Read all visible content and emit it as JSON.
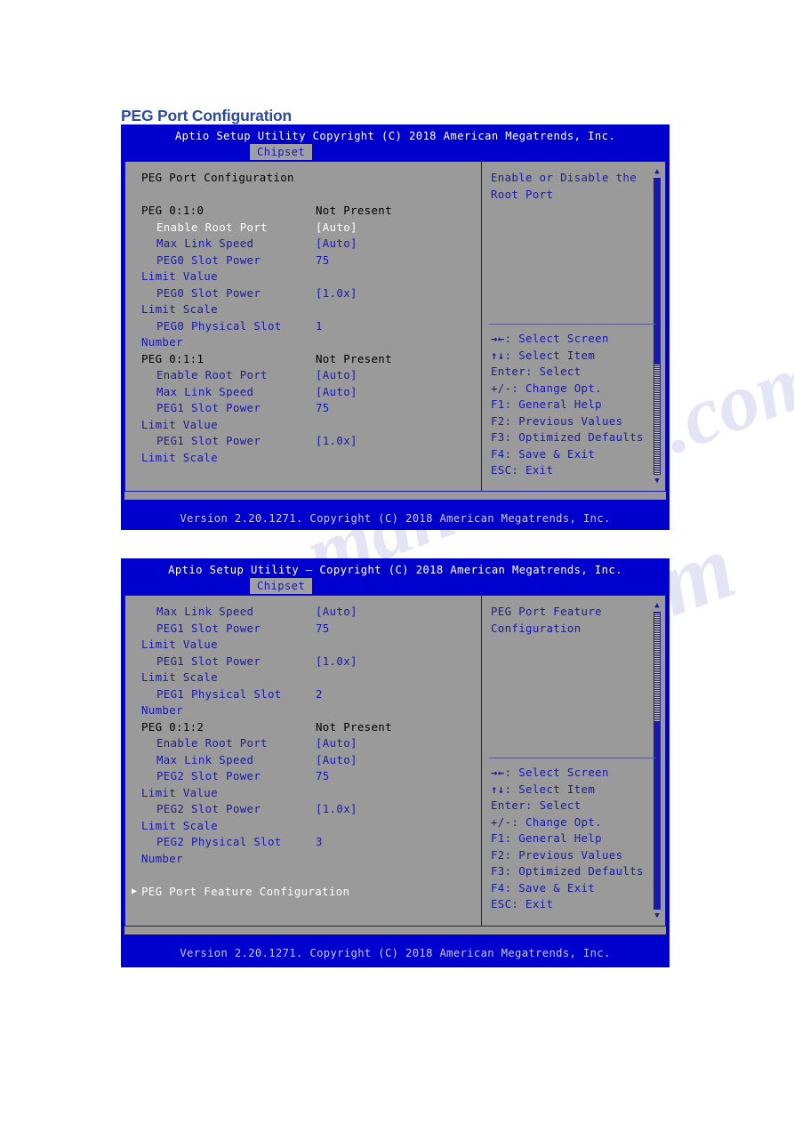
{
  "page": {
    "title": "PEG Port Configuration",
    "watermark": "manualslib.com"
  },
  "screens": [
    {
      "titlebar": "Aptio Setup Utility    Copyright (C) 2018 American Megatrends, Inc.",
      "tab": "Chipset",
      "footer": "Version 2.20.1271. Copyright (C) 2018 American Megatrends, Inc.",
      "scroll": {
        "up_arrow": "▲",
        "down_arrow": "▼",
        "thumb_top_pct": 0,
        "thumb_height_pct": 63
      },
      "rows": [
        {
          "label": "PEG Port Configuration",
          "value": "",
          "style": "header",
          "indent": false
        },
        {
          "label": "",
          "value": "",
          "style": "spacer",
          "indent": false
        },
        {
          "label": "PEG 0:1:0",
          "value": "Not Present",
          "style": "header",
          "indent": false
        },
        {
          "label": "Enable Root Port",
          "value": "[Auto]",
          "style": "selected",
          "indent": true
        },
        {
          "label": "Max Link Speed",
          "value": "[Auto]",
          "style": "normal",
          "indent": true
        },
        {
          "label": "PEG0 Slot Power",
          "value": "75",
          "style": "normal",
          "indent": true
        },
        {
          "label": "Limit Value",
          "value": "",
          "style": "normal",
          "indent": false
        },
        {
          "label": "PEG0 Slot Power",
          "value": "[1.0x]",
          "style": "normal",
          "indent": true
        },
        {
          "label": "Limit Scale",
          "value": "",
          "style": "normal",
          "indent": false
        },
        {
          "label": "PEG0 Physical Slot",
          "value": "1",
          "style": "normal",
          "indent": true
        },
        {
          "label": "Number",
          "value": "",
          "style": "normal",
          "indent": false
        },
        {
          "label": "PEG 0:1:1",
          "value": "Not Present",
          "style": "header",
          "indent": false
        },
        {
          "label": "Enable Root Port",
          "value": "[Auto]",
          "style": "normal",
          "indent": true
        },
        {
          "label": "Max Link Speed",
          "value": "[Auto]",
          "style": "normal",
          "indent": true
        },
        {
          "label": "PEG1 Slot Power",
          "value": "75",
          "style": "normal",
          "indent": true
        },
        {
          "label": "Limit Value",
          "value": "",
          "style": "normal",
          "indent": false
        },
        {
          "label": "PEG1 Slot Power",
          "value": "[1.0x]",
          "style": "normal",
          "indent": true
        },
        {
          "label": "Limit Scale",
          "value": "",
          "style": "normal",
          "indent": false
        }
      ],
      "help": [
        "Enable or Disable the",
        "Root Port"
      ],
      "keys": [
        {
          "glyph": "→←",
          "text": ": Select Screen"
        },
        {
          "glyph": "↑↓",
          "text": ": Select Item"
        },
        {
          "glyph": "",
          "text": "Enter: Select"
        },
        {
          "glyph": "",
          "text": "+/-: Change Opt."
        },
        {
          "glyph": "",
          "text": "F1: General Help"
        },
        {
          "glyph": "",
          "text": "F2: Previous Values"
        },
        {
          "glyph": "",
          "text": "F3: Optimized Defaults"
        },
        {
          "glyph": "",
          "text": "F4: Save & Exit"
        },
        {
          "glyph": "",
          "text": "ESC: Exit"
        }
      ]
    },
    {
      "titlebar": "Aptio Setup Utility – Copyright (C) 2018 American Megatrends, Inc.",
      "tab": "Chipset",
      "footer": "Version 2.20.1271. Copyright (C) 2018 American Megatrends, Inc.",
      "scroll": {
        "up_arrow": "▲",
        "down_arrow": "▼",
        "thumb_top_pct": 37,
        "thumb_height_pct": 63
      },
      "rows": [
        {
          "label": "Max Link Speed",
          "value": "[Auto]",
          "style": "normal",
          "indent": true
        },
        {
          "label": "PEG1 Slot Power",
          "value": "75",
          "style": "normal",
          "indent": true
        },
        {
          "label": "Limit Value",
          "value": "",
          "style": "normal",
          "indent": false
        },
        {
          "label": "PEG1 Slot Power",
          "value": "[1.0x]",
          "style": "normal",
          "indent": true
        },
        {
          "label": "Limit Scale",
          "value": "",
          "style": "normal",
          "indent": false
        },
        {
          "label": "PEG1 Physical Slot",
          "value": "2",
          "style": "normal",
          "indent": true
        },
        {
          "label": "Number",
          "value": "",
          "style": "normal",
          "indent": false
        },
        {
          "label": "PEG 0:1:2",
          "value": "Not Present",
          "style": "header",
          "indent": false
        },
        {
          "label": "Enable Root Port",
          "value": "[Auto]",
          "style": "normal",
          "indent": true
        },
        {
          "label": "Max Link Speed",
          "value": "[Auto]",
          "style": "normal",
          "indent": true
        },
        {
          "label": "PEG2 Slot Power",
          "value": "75",
          "style": "normal",
          "indent": true
        },
        {
          "label": "Limit Value",
          "value": "",
          "style": "normal",
          "indent": false
        },
        {
          "label": "PEG2 Slot Power",
          "value": "[1.0x]",
          "style": "normal",
          "indent": true
        },
        {
          "label": "Limit Scale",
          "value": "",
          "style": "normal",
          "indent": false
        },
        {
          "label": "PEG2 Physical Slot",
          "value": "3",
          "style": "normal",
          "indent": true
        },
        {
          "label": "Number",
          "value": "",
          "style": "normal",
          "indent": false
        },
        {
          "label": "",
          "value": "",
          "style": "spacer",
          "indent": false
        },
        {
          "label": "PEG Port Feature Configuration",
          "value": "",
          "style": "selected",
          "indent": false,
          "submenu": "▶"
        }
      ],
      "help": [
        "PEG Port Feature",
        "Configuration"
      ],
      "keys": [
        {
          "glyph": "→←",
          "text": ": Select Screen"
        },
        {
          "glyph": "↑↓",
          "text": ": Select Item"
        },
        {
          "glyph": "",
          "text": "Enter: Select"
        },
        {
          "glyph": "",
          "text": "+/-: Change Opt."
        },
        {
          "glyph": "",
          "text": "F1: General Help"
        },
        {
          "glyph": "",
          "text": "F2: Previous Values"
        },
        {
          "glyph": "",
          "text": "F3: Optimized Defaults"
        },
        {
          "glyph": "",
          "text": "F4: Save & Exit"
        },
        {
          "glyph": "",
          "text": "ESC: Exit"
        }
      ]
    }
  ]
}
